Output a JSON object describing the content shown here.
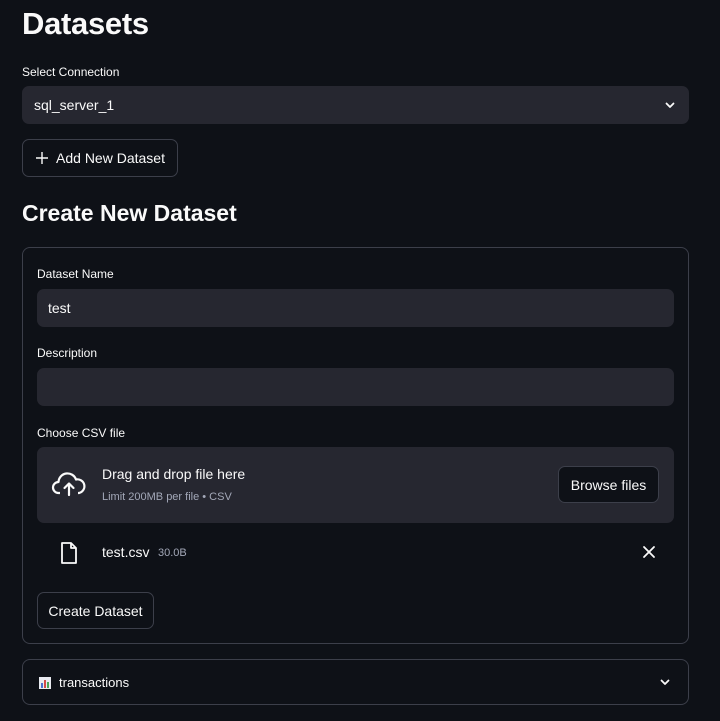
{
  "page": {
    "title": "Datasets"
  },
  "connection": {
    "label": "Select Connection",
    "value": "sql_server_1"
  },
  "add_dataset_button": "Add New Dataset",
  "create_section": {
    "title": "Create New Dataset",
    "name_label": "Dataset Name",
    "name_value": "test",
    "description_label": "Description",
    "description_value": "",
    "csv_label": "Choose CSV file",
    "dropzone": {
      "title": "Drag and drop file here",
      "subtitle": "Limit 200MB per file • CSV",
      "browse_label": "Browse files"
    },
    "uploaded_file": {
      "name": "test.csv",
      "size": "30.0B"
    },
    "submit_label": "Create Dataset"
  },
  "expander": {
    "icon": "bar-chart-icon",
    "label": "transactions"
  },
  "colors": {
    "background": "#0e1117",
    "input_bg": "#262730",
    "border": "#3c3f4a",
    "text": "#fafafa",
    "muted": "#a3a8b8"
  }
}
